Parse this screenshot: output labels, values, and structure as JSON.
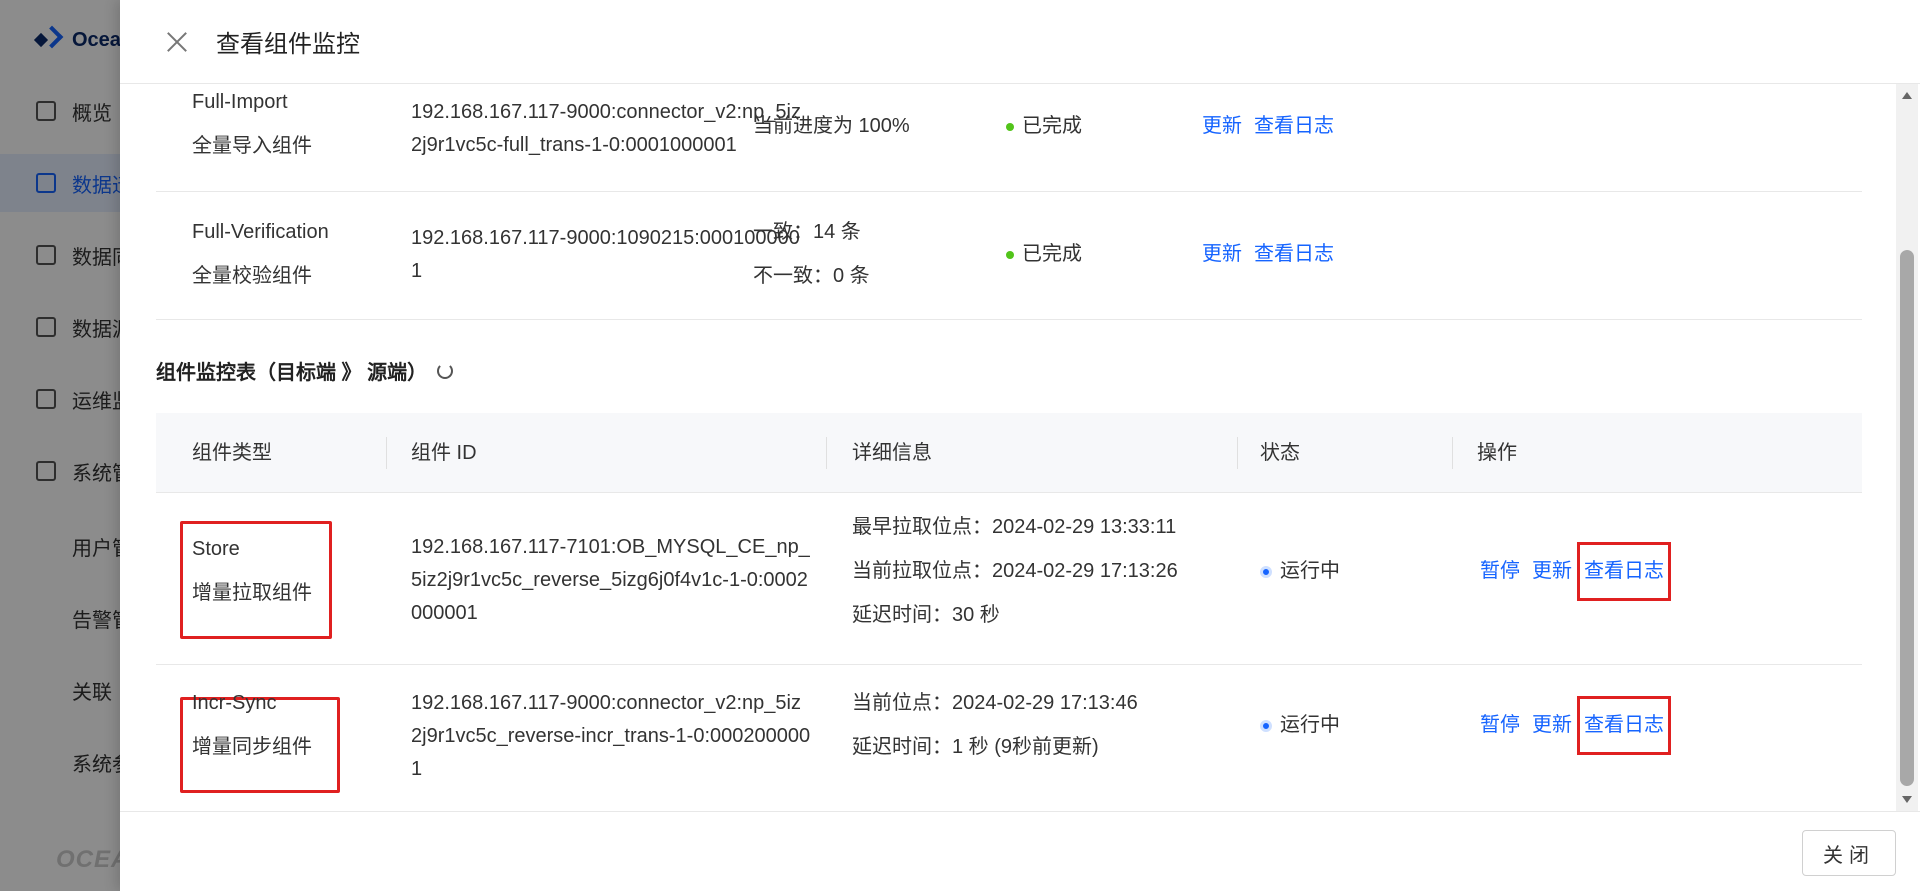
{
  "sidebar": {
    "logo_text": "Ocea",
    "items": [
      {
        "label": "概览"
      },
      {
        "label": "数据迁"
      },
      {
        "label": "数据同"
      },
      {
        "label": "数据源"
      },
      {
        "label": "运维监"
      },
      {
        "label": "系统管"
      }
    ],
    "sub_items": [
      {
        "label": "用户管"
      },
      {
        "label": "告警管"
      },
      {
        "label": "关联"
      },
      {
        "label": "系统参"
      }
    ],
    "brand_bottom": "OCEA"
  },
  "drawer": {
    "title": "查看组件监控",
    "close_button": "关闭"
  },
  "top_rows": [
    {
      "type_en": "Full-Import",
      "type_cn": "全量导入组件",
      "id": "192.168.167.117-9000:connector_v2:np_5iz2j9r1vc5c-full_trans-1-0:0001000001",
      "info": [
        "当前进度为 100%"
      ],
      "status": "已完成",
      "ops": [
        "更新",
        "查看日志"
      ]
    },
    {
      "type_en": "Full-Verification",
      "type_cn": "全量校验组件",
      "id": "192.168.167.117-9000:1090215:0001000001",
      "info": [
        "一致：14 条",
        "不一致：0 条"
      ],
      "status": "已完成",
      "ops": [
        "更新",
        "查看日志"
      ]
    }
  ],
  "section": {
    "title": "组件监控表（目标端 》 源端）"
  },
  "table": {
    "headers": [
      "组件类型",
      "组件 ID",
      "详细信息",
      "状态",
      "操作"
    ],
    "rows": [
      {
        "type_en": "Store",
        "type_cn": "增量拉取组件",
        "id": "192.168.167.117-7101:OB_MYSQL_CE_np_5iz2j9r1vc5c_reverse_5izg6j0f4v1c-1-0:0002000001",
        "info": [
          "最早拉取位点：2024-02-29 13:33:11",
          "当前拉取位点：2024-02-29 17:13:26",
          "延迟时间：30 秒"
        ],
        "status": "运行中",
        "ops": [
          "暂停",
          "更新",
          "查看日志"
        ]
      },
      {
        "type_en": "Incr-Sync",
        "type_cn": "增量同步组件",
        "id": "192.168.167.117-9000:connector_v2:np_5iz2j9r1vc5c_reverse-incr_trans-1-0:0002000001",
        "info": [
          "当前位点：2024-02-29 17:13:46",
          "延迟时间：1 秒 (9秒前更新)"
        ],
        "status": "运行中",
        "ops": [
          "暂停",
          "更新",
          "查看日志"
        ]
      }
    ]
  }
}
